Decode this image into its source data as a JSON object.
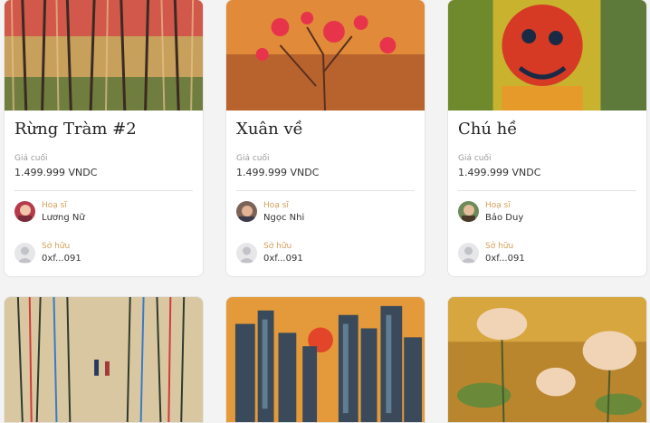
{
  "cards": [
    {
      "title": "Rừng Tràm #2",
      "price_label": "Giá cuối",
      "price": "1.499.999 VNDC",
      "artist_role": "Hoạ sĩ",
      "artist_name": "Lương Nữ",
      "owner_role": "Sở hữu",
      "owner_address": "0xf...091"
    },
    {
      "title": "Xuân về",
      "price_label": "Giá cuối",
      "price": "1.499.999 VNDC",
      "artist_role": "Hoạ sĩ",
      "artist_name": "Ngọc Nhi",
      "owner_role": "Sở hữu",
      "owner_address": "0xf...091"
    },
    {
      "title": "Chú hề",
      "price_label": "Giá cuối",
      "price": "1.499.999 VNDC",
      "artist_role": "Hoạ sĩ",
      "artist_name": "Bảo Duy",
      "owner_role": "Sở hữu",
      "owner_address": "0xf...091"
    }
  ],
  "colors": {
    "background": "#f3f3f3",
    "card": "#ffffff",
    "role_label": "#d4a05a"
  }
}
